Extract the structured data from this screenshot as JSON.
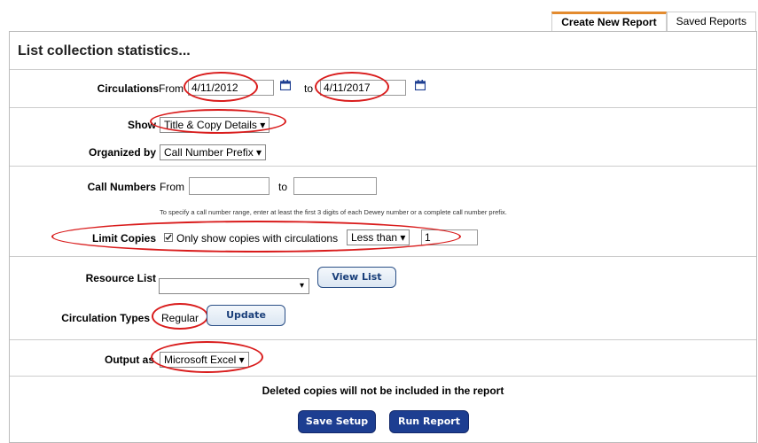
{
  "tabs": [
    "Create New Report",
    "Saved Reports"
  ],
  "panel_title": "List collection statistics...",
  "circulations": {
    "label": "Circulations",
    "from": "From",
    "from_value": "4/11/2012",
    "to": "to",
    "to_value": "4/11/2017"
  },
  "show": {
    "label": "Show",
    "value": "Title & Copy Details ▾"
  },
  "organized": {
    "label": "Organized by",
    "value": "Call Number Prefix ▾"
  },
  "call_numbers": {
    "label": "Call Numbers",
    "from": "From",
    "to": "to",
    "hint": "To specify a call number range, enter at least the first 3 digits of each Dewey number or a complete call number prefix."
  },
  "limit": {
    "label": "Limit Copies",
    "checkbox_text": "Only show copies with circulations",
    "checked": true,
    "comparison": "Less than ▾",
    "value": "1"
  },
  "resource": {
    "label": "Resource List",
    "value": "",
    "view_button": "View List"
  },
  "circ_types": {
    "label": "Circulation Types",
    "value": "Regular",
    "update_button": "Update"
  },
  "output": {
    "label": "Output as",
    "value": "Microsoft Excel ▾"
  },
  "note": "Deleted copies will not be included in the report",
  "buttons": {
    "save": "Save Setup",
    "run": "Run Report"
  },
  "colors": {
    "annotation": "#d91c1c",
    "button_dark": "#1d3e91",
    "tab_accent": "#e38b2e"
  }
}
